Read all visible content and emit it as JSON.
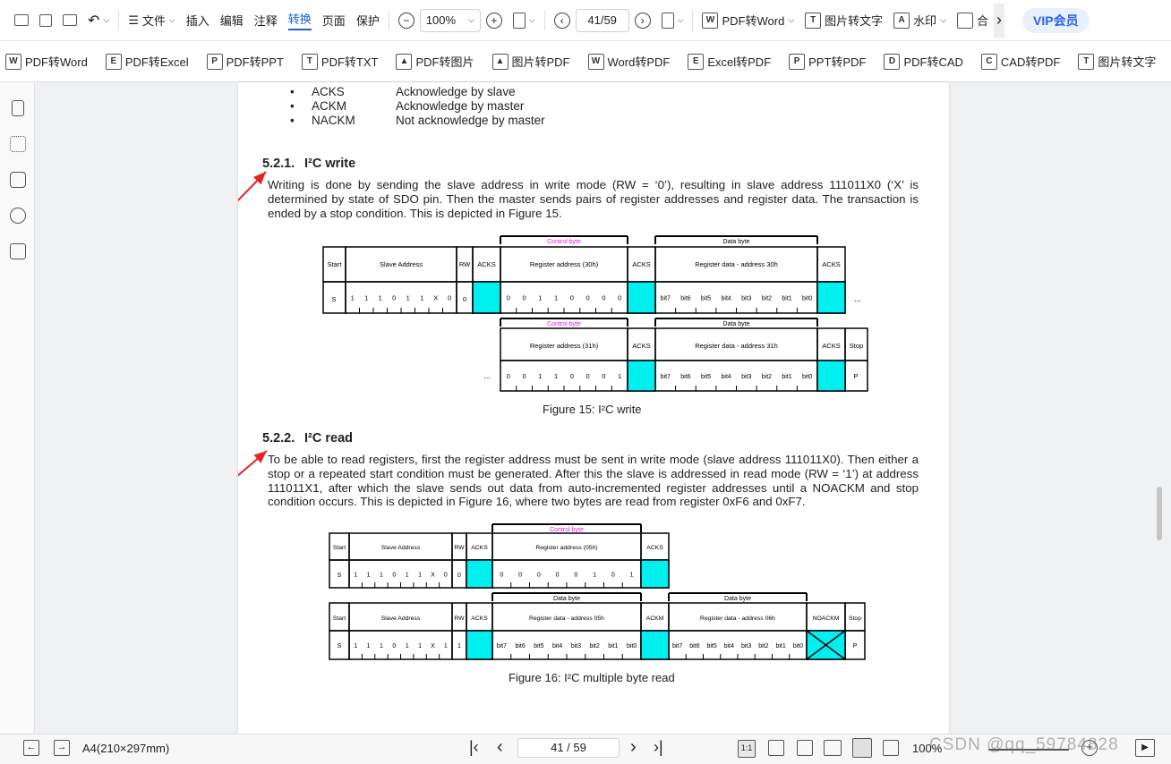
{
  "toolbar1": {
    "undo_label": "",
    "menus": [
      "文件",
      "插入",
      "编辑",
      "注释",
      "转换",
      "页面",
      "保护"
    ],
    "active_menu": "转换",
    "zoom": "100%",
    "page": "41/59",
    "pdf_to_word": "PDF转Word",
    "img_to_text": "图片转文字",
    "watermark": "水印",
    "merge": "合",
    "vip": "VIP会员"
  },
  "toolbar2": {
    "items": [
      "PDF转Word",
      "PDF转Excel",
      "PDF转PPT",
      "PDF转TXT",
      "PDF转图片",
      "图片转PDF",
      "Word转PDF",
      "Excel转PDF",
      "PPT转PDF",
      "PDF转CAD",
      "CAD转PDF",
      "图片转文字"
    ]
  },
  "doc": {
    "bullets": [
      {
        "k": "ACKS",
        "v": "Acknowledge by slave"
      },
      {
        "k": "ACKM",
        "v": "Acknowledge by master"
      },
      {
        "k": "NACKM",
        "v": "Not acknowledge by master"
      }
    ],
    "s1_num": "5.2.1.",
    "s1_title": "I²C write",
    "s1_para": "Writing is done by sending the slave address in write mode (RW = ‘0’), resulting in slave address 111011X0 (‘X’ is determined by state of SDO pin. Then the master sends pairs of register addresses and register data. The transaction is ended by a stop condition. This is depicted in Figure 15.",
    "fig15": "Figure 15: I²C write",
    "s2_num": "5.2.2.",
    "s2_title": "I²C read",
    "s2_para": "To be able to read registers, first the register address must be sent in write mode (slave address 111011X0). Then either a stop or a repeated start condition must be generated. After this the slave is addressed in read mode (RW = ‘1’) at address 111011X1, after which the slave sends out data from auto-incremented register addresses until a NOACKM and stop condition occurs. This is depicted in Figure 16, where two bytes are read from register 0xF6 and 0xF7.",
    "fig16": "Figure 16: I²C multiple byte read",
    "diagram": {
      "control_byte": "Control byte",
      "data_byte": "Data byte",
      "start": "Start",
      "slave_address": "Slave Address",
      "rw": "RW",
      "acks": "ACKS",
      "ackm": "ACKM",
      "noackm": "NOACKM",
      "stop": "Stop",
      "reg30": "Register address (30h)",
      "data30": "Register data -  address 30h",
      "reg31": "Register address (31h)",
      "data31": "Register data -  address 31h",
      "reg05": "Register address (05h)",
      "data05": "Register data - address 05h",
      "data06": "Register data - address 06h",
      "s": "S",
      "p": "P",
      "ellipsis": "...",
      "slave_bits_w": [
        "1",
        "1",
        "1",
        "0",
        "1",
        "1",
        "X",
        "0"
      ],
      "slave_bits_r": [
        "1",
        "1",
        "1",
        "0",
        "1",
        "1",
        "X",
        "1"
      ],
      "reg30_bits": [
        "0",
        "0",
        "1",
        "1",
        "0",
        "0",
        "0",
        "0"
      ],
      "reg31_bits": [
        "0",
        "0",
        "1",
        "1",
        "0",
        "0",
        "0",
        "1"
      ],
      "reg05_bits": [
        "0",
        "0",
        "0",
        "0",
        "0",
        "1",
        "0",
        "1"
      ],
      "data_bits": [
        "bit7",
        "bit6",
        "bit5",
        "bit4",
        "bit3",
        "bit2",
        "bit1",
        "bit0"
      ]
    }
  },
  "status": {
    "paper": "A4(210×297mm)",
    "page": "41 / 59",
    "zoom": "100%",
    "watermark": "CSDN @qq_59784828"
  },
  "colors": {
    "accent": "#1a5fd8",
    "cyan": "#00f0f0",
    "magenta": "#e020e0",
    "arrow": "#e8231f"
  }
}
